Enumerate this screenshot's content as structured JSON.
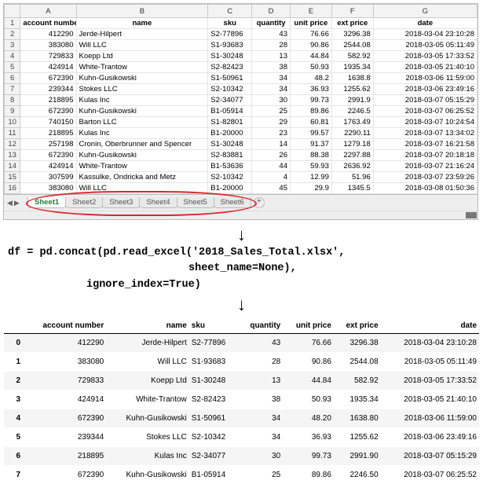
{
  "excel": {
    "col_letters": [
      "A",
      "B",
      "C",
      "D",
      "E",
      "F",
      "G"
    ],
    "headers": [
      "account number",
      "name",
      "sku",
      "quantity",
      "unit price",
      "ext price",
      "date"
    ],
    "rows": [
      [
        "412290",
        "Jerde-Hilpert",
        "S2-77896",
        "43",
        "76.66",
        "3296.38",
        "2018-03-04 23:10:28"
      ],
      [
        "383080",
        "Will LLC",
        "S1-93683",
        "28",
        "90.86",
        "2544.08",
        "2018-03-05 05:11:49"
      ],
      [
        "729833",
        "Koepp Ltd",
        "S1-30248",
        "13",
        "44.84",
        "582.92",
        "2018-03-05 17:33:52"
      ],
      [
        "424914",
        "White-Trantow",
        "S2-82423",
        "38",
        "50.93",
        "1935.34",
        "2018-03-05 21:40:10"
      ],
      [
        "672390",
        "Kuhn-Gusikowski",
        "S1-50961",
        "34",
        "48.2",
        "1638.8",
        "2018-03-06 11:59:00"
      ],
      [
        "239344",
        "Stokes LLC",
        "S2-10342",
        "34",
        "36.93",
        "1255.62",
        "2018-03-06 23:49:16"
      ],
      [
        "218895",
        "Kulas Inc",
        "S2-34077",
        "30",
        "99.73",
        "2991.9",
        "2018-03-07 05:15:29"
      ],
      [
        "672390",
        "Kuhn-Gusikowski",
        "B1-05914",
        "25",
        "89.86",
        "2246.5",
        "2018-03-07 06:25:52"
      ],
      [
        "740150",
        "Barton LLC",
        "S1-82801",
        "29",
        "60.81",
        "1763.49",
        "2018-03-07 10:24:54"
      ],
      [
        "218895",
        "Kulas Inc",
        "B1-20000",
        "23",
        "99.57",
        "2290.11",
        "2018-03-07 13:34:02"
      ],
      [
        "257198",
        "Cronin, Oberbrunner and Spencer",
        "S1-30248",
        "14",
        "91.37",
        "1279.18",
        "2018-03-07 16:21:58"
      ],
      [
        "672390",
        "Kuhn-Gusikowski",
        "S2-83881",
        "26",
        "88.38",
        "2297.88",
        "2018-03-07 20:18:18"
      ],
      [
        "424914",
        "White-Trantow",
        "B1-53636",
        "44",
        "59.93",
        "2636.92",
        "2018-03-07 21:16:24"
      ],
      [
        "307599",
        "Kassulke, Ondricka and Metz",
        "S2-10342",
        "4",
        "12.99",
        "51.96",
        "2018-03-07 23:59:26"
      ],
      [
        "383080",
        "Will LLC",
        "B1-20000",
        "45",
        "29.9",
        "1345.5",
        "2018-03-08 01:50:36"
      ]
    ],
    "sheets": [
      "Sheet1",
      "Sheet2",
      "Sheet3",
      "Sheet4",
      "Sheet5",
      "Sheet6"
    ]
  },
  "code": {
    "line1": "df = pd.concat(pd.read_excel('2018_Sales_Total.xlsx',",
    "line2": "sheet_name=None),",
    "line3": "ignore_index=True)"
  },
  "df": {
    "headers": [
      "account number",
      "name",
      "sku",
      "quantity",
      "unit price",
      "ext price",
      "date"
    ],
    "rows": [
      [
        "0",
        "412290",
        "Jerde-Hilpert",
        "S2-77896",
        "43",
        "76.66",
        "3296.38",
        "2018-03-04 23:10:28"
      ],
      [
        "1",
        "383080",
        "Will LLC",
        "S1-93683",
        "28",
        "90.86",
        "2544.08",
        "2018-03-05 05:11:49"
      ],
      [
        "2",
        "729833",
        "Koepp Ltd",
        "S1-30248",
        "13",
        "44.84",
        "582.92",
        "2018-03-05 17:33:52"
      ],
      [
        "3",
        "424914",
        "White-Trantow",
        "S2-82423",
        "38",
        "50.93",
        "1935.34",
        "2018-03-05 21:40:10"
      ],
      [
        "4",
        "672390",
        "Kuhn-Gusikowski",
        "S1-50961",
        "34",
        "48.20",
        "1638.80",
        "2018-03-06 11:59:00"
      ],
      [
        "5",
        "239344",
        "Stokes LLC",
        "S2-10342",
        "34",
        "36.93",
        "1255.62",
        "2018-03-06 23:49:16"
      ],
      [
        "6",
        "218895",
        "Kulas Inc",
        "S2-34077",
        "30",
        "99.73",
        "2991.90",
        "2018-03-07 05:15:29"
      ],
      [
        "7",
        "672390",
        "Kuhn-Gusikowski",
        "B1-05914",
        "25",
        "89.86",
        "2246.50",
        "2018-03-07 06:25:52"
      ]
    ]
  }
}
